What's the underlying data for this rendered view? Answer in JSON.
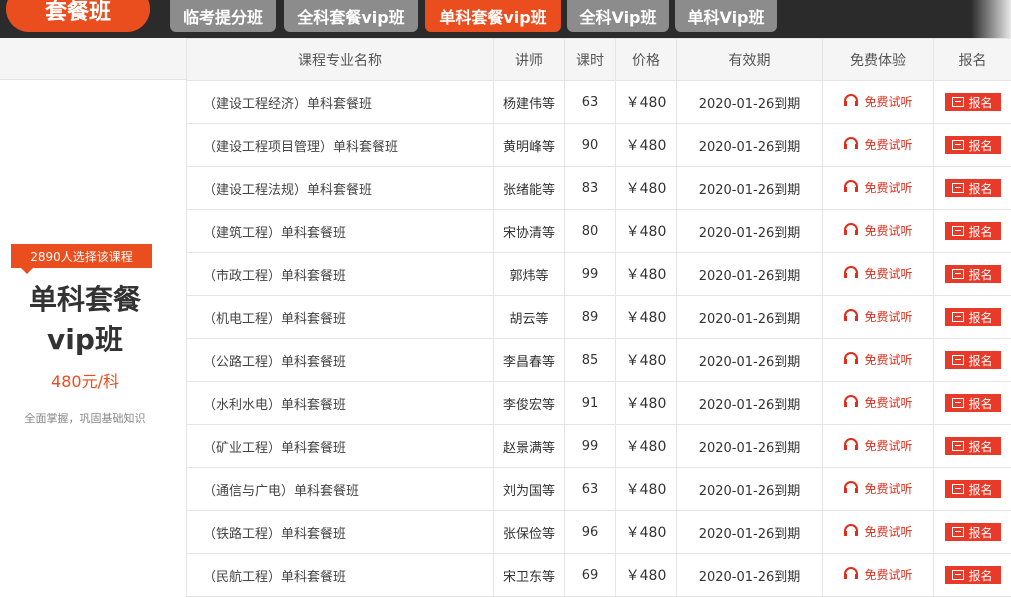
{
  "brand": {
    "label": "套餐班"
  },
  "tabs": [
    {
      "label": "临考提分班",
      "active": false
    },
    {
      "label": "全科套餐vip班",
      "active": false
    },
    {
      "label": "单科套餐vip班",
      "active": true
    },
    {
      "label": "全科Vip班",
      "active": false
    },
    {
      "label": "单科Vip班",
      "active": false
    }
  ],
  "promo": {
    "badge": "2890人选择该课程",
    "title_line1": "单科套餐",
    "title_line2": "vip班",
    "price": "480元/科",
    "subtitle": "全面掌握，巩固基础知识"
  },
  "table": {
    "headers": {
      "name": "课程专业名称",
      "teacher": "讲师",
      "hours": "课时",
      "price": "价格",
      "validity": "有效期",
      "trial": "免费体验",
      "signup": "报名"
    },
    "trial_label": "免费试听",
    "signup_label": "报名",
    "rows": [
      {
        "name": "（建设工程经济）单科套餐班",
        "teacher": "杨建伟等",
        "hours": "63",
        "price": "￥480",
        "validity": "2020-01-26到期"
      },
      {
        "name": "（建设工程项目管理）单科套餐班",
        "teacher": "黄明峰等",
        "hours": "90",
        "price": "￥480",
        "validity": "2020-01-26到期"
      },
      {
        "name": "（建设工程法规）单科套餐班",
        "teacher": "张绪能等",
        "hours": "83",
        "price": "￥480",
        "validity": "2020-01-26到期"
      },
      {
        "name": "（建筑工程）单科套餐班",
        "teacher": "宋协清等",
        "hours": "80",
        "price": "￥480",
        "validity": "2020-01-26到期"
      },
      {
        "name": "（市政工程）单科套餐班",
        "teacher": "郭炜等",
        "hours": "99",
        "price": "￥480",
        "validity": "2020-01-26到期"
      },
      {
        "name": "（机电工程）单科套餐班",
        "teacher": "胡云等",
        "hours": "89",
        "price": "￥480",
        "validity": "2020-01-26到期"
      },
      {
        "name": "（公路工程）单科套餐班",
        "teacher": "李昌春等",
        "hours": "85",
        "price": "￥480",
        "validity": "2020-01-26到期"
      },
      {
        "name": "（水利水电）单科套餐班",
        "teacher": "李俊宏等",
        "hours": "91",
        "price": "￥480",
        "validity": "2020-01-26到期"
      },
      {
        "name": "（矿业工程）单科套餐班",
        "teacher": "赵景满等",
        "hours": "99",
        "price": "￥480",
        "validity": "2020-01-26到期"
      },
      {
        "name": "（通信与广电）单科套餐班",
        "teacher": "刘为国等",
        "hours": "63",
        "price": "￥480",
        "validity": "2020-01-26到期"
      },
      {
        "name": "（铁路工程）单科套餐班",
        "teacher": "张保俭等",
        "hours": "96",
        "price": "￥480",
        "validity": "2020-01-26到期"
      },
      {
        "name": "（民航工程）单科套餐班",
        "teacher": "宋卫东等",
        "hours": "69",
        "price": "￥480",
        "validity": "2020-01-26到期"
      }
    ]
  },
  "icons": {
    "trial": "headphone-icon",
    "signup": "document-icon"
  },
  "colors": {
    "accent": "#ea4e1f",
    "tab_inactive": "#8c8c8c",
    "tabbar": "#2b2b2b",
    "price": "#e5431d"
  }
}
